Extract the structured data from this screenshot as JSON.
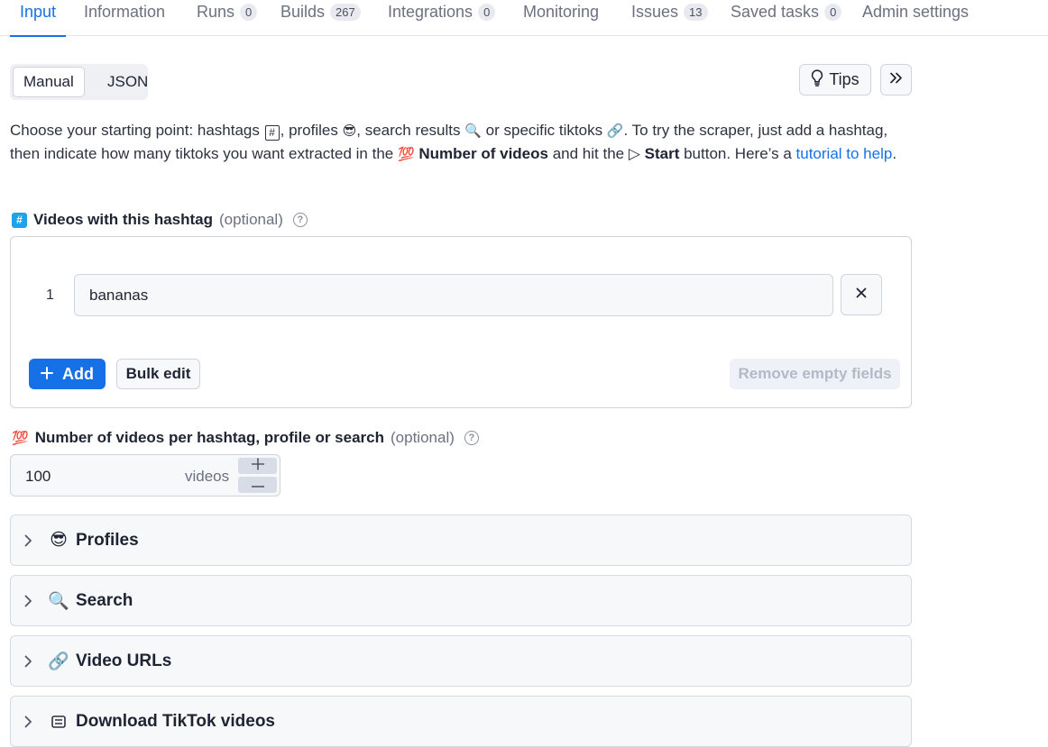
{
  "tabs": [
    {
      "label": "Input",
      "badge": ""
    },
    {
      "label": "Information",
      "badge": ""
    },
    {
      "label": "Runs",
      "badge": "0"
    },
    {
      "label": "Builds",
      "badge": "267"
    },
    {
      "label": "Integrations",
      "badge": "0"
    },
    {
      "label": "Monitoring",
      "badge": ""
    },
    {
      "label": "Issues",
      "badge": "13"
    },
    {
      "label": "Saved tasks",
      "badge": "0"
    },
    {
      "label": "Admin settings",
      "badge": ""
    }
  ],
  "active_tab": "Input",
  "mode_toggle": {
    "manual": "Manual",
    "json": "JSON",
    "selected": "Manual"
  },
  "tips_button": "Tips",
  "intro": {
    "p1": "Choose your starting point: hashtags",
    "p2": ", profiles",
    "p3": ", search results",
    "p4": " or specific tiktoks",
    "p5": ". To try the scraper, just add a hashtag, then indicate how many tiktoks you want extracted in the",
    "bold1": "Number of videos",
    "p6": " and hit the ▷",
    "bold2": "Start",
    "p7": " button. Here’s a ",
    "link": "tutorial to help",
    "p8": "."
  },
  "hashtag_field": {
    "label": "Videos with this hashtag",
    "optional": "(optional)",
    "rows": [
      {
        "index": "1",
        "value": "bananas"
      }
    ],
    "add_label": "Add",
    "bulk_edit_label": "Bulk edit",
    "remove_empty_label": "Remove empty fields"
  },
  "videos_count_field": {
    "label": "Number of videos per hashtag, profile or search",
    "optional": "(optional)",
    "value": "100",
    "unit": "videos"
  },
  "sections": [
    {
      "label": "Profiles",
      "icon": "sunglasses-emoji"
    },
    {
      "label": "Search",
      "icon": "magnifier-emoji"
    },
    {
      "label": "Video URLs",
      "icon": "link-emoji"
    },
    {
      "label": "Download TikTok videos",
      "icon": "video-download-emoji"
    }
  ],
  "colors": {
    "accent": "#1671e6",
    "text": "#1f2433",
    "muted": "#6b7180",
    "border": "#cfd3dc"
  }
}
